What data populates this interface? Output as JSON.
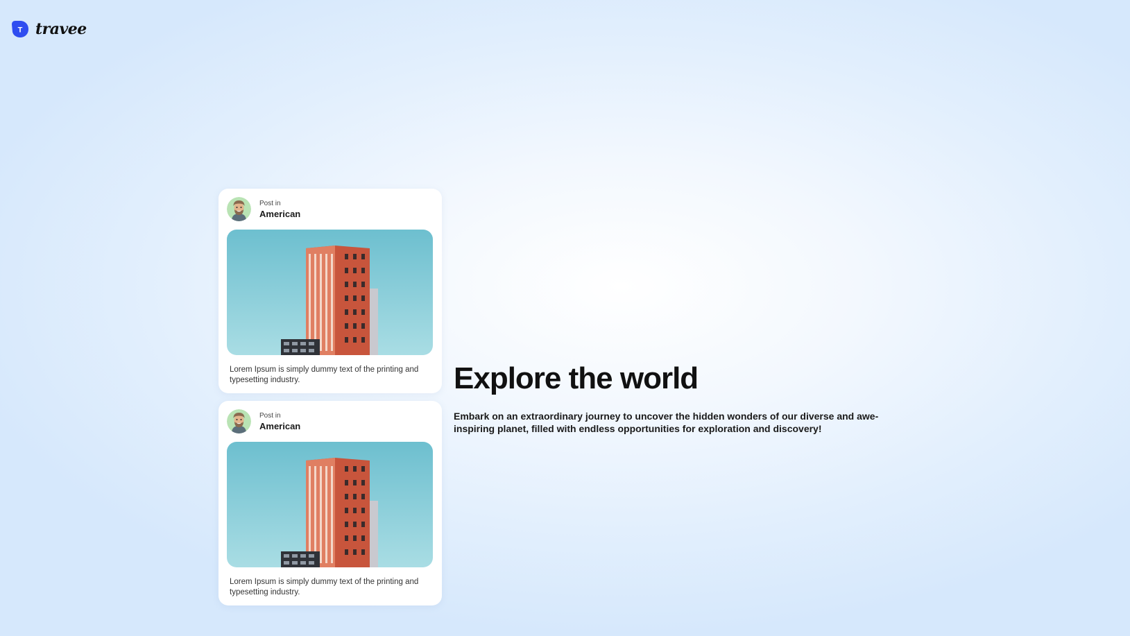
{
  "brand": {
    "name": "travee",
    "logo_letter": "T",
    "logo_color": "#2f4df0",
    "logo_icon": "travee-logo-icon"
  },
  "posts": [
    {
      "label": "Post in",
      "location": "American",
      "caption": "Lorem Ipsum is simply dummy text of the printing and typesetting industry.",
      "avatar_icon": "user-avatar-icon"
    },
    {
      "label": "Post in",
      "location": "American",
      "caption": "Lorem Ipsum is simply dummy text of the printing and typesetting industry.",
      "avatar_icon": "user-avatar-icon"
    }
  ],
  "hero": {
    "title": "Explore the world",
    "description": "Embark on an extraordinary journey to uncover the hidden wonders of our diverse and awe-inspiring planet, filled with endless opportunities for exploration and discovery!"
  },
  "colors": {
    "background": "#dbeafc",
    "card": "#ffffff",
    "accent": "#2f4df0",
    "sky_top": "#6dbfcf",
    "sky_bottom": "#a9dde4",
    "building": "#c8553c"
  }
}
